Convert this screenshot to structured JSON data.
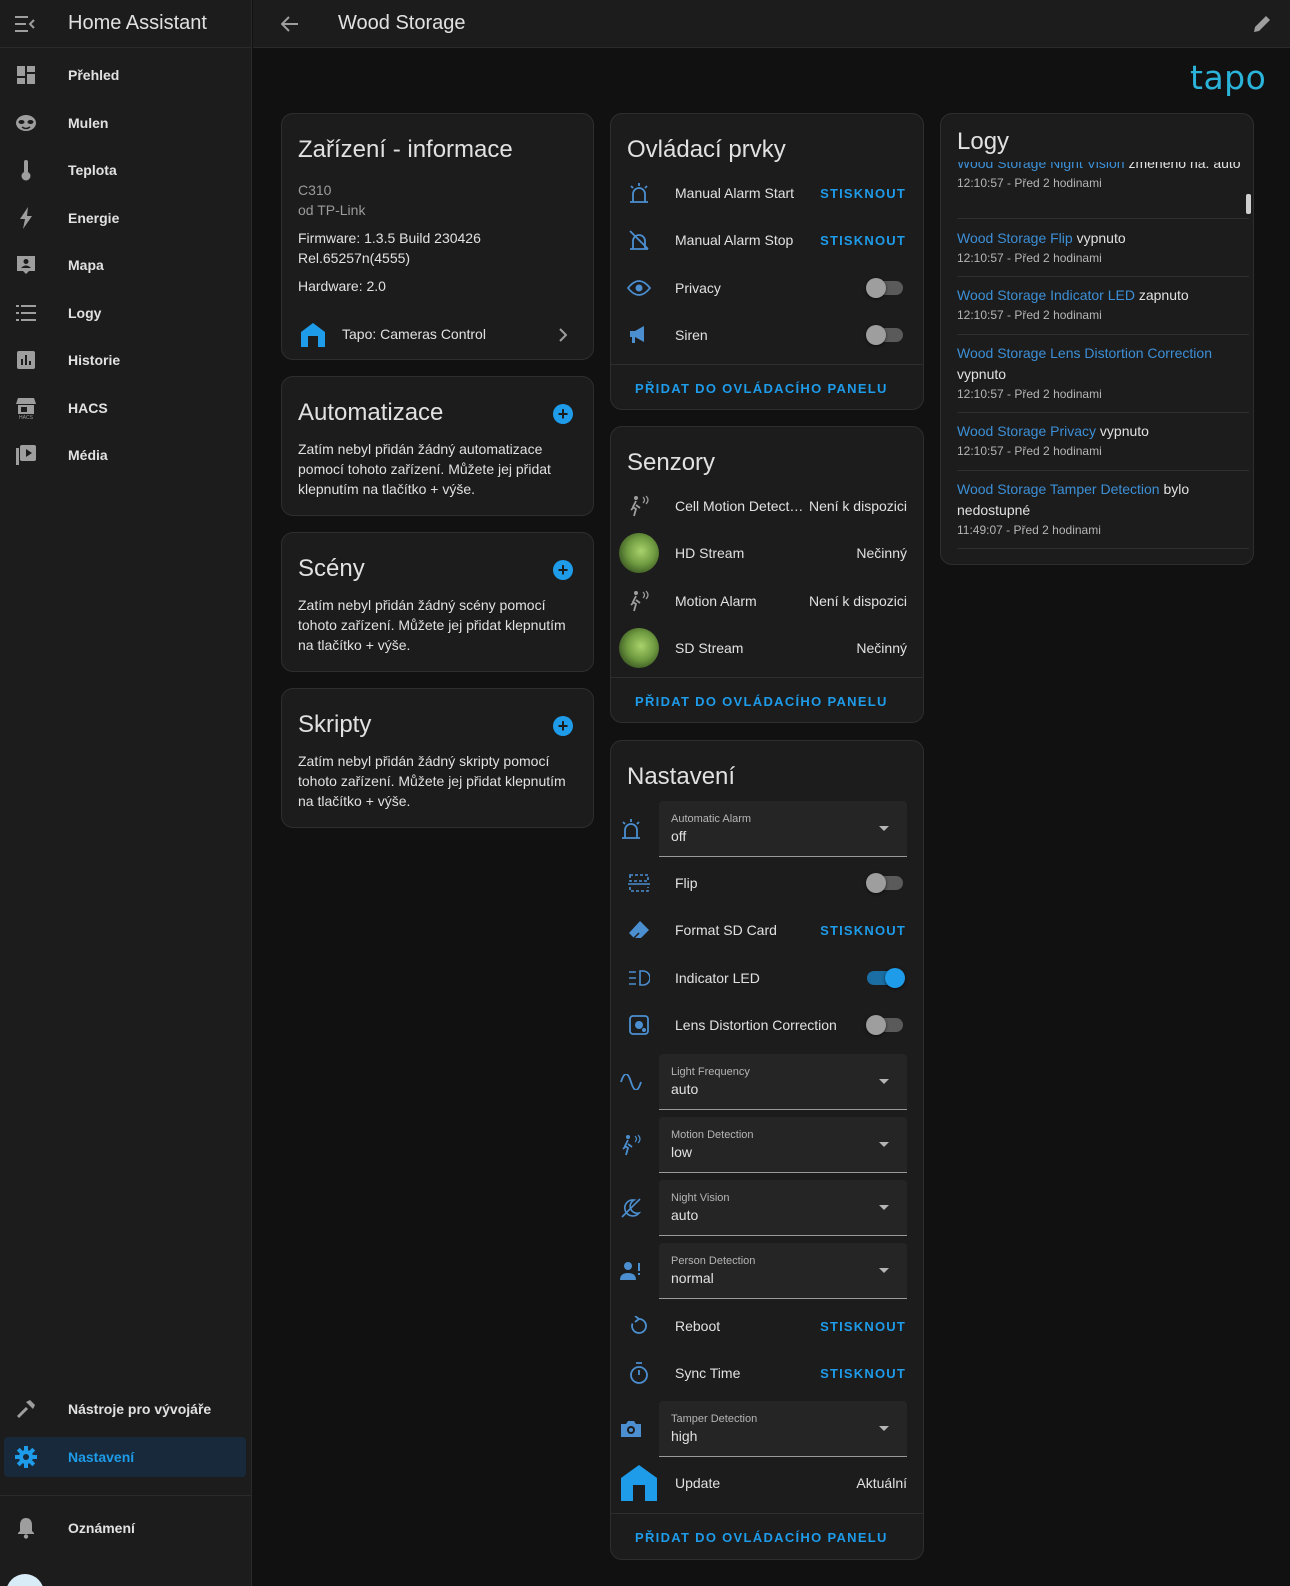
{
  "app": {
    "title": "Home Assistant"
  },
  "sidebar": {
    "items": [
      {
        "label": "Přehled",
        "icon": "dashboard-icon"
      },
      {
        "label": "Mulen",
        "icon": "mask-icon"
      },
      {
        "label": "Teplota",
        "icon": "thermometer-icon"
      },
      {
        "label": "Energie",
        "icon": "lightning-icon"
      },
      {
        "label": "Mapa",
        "icon": "map-account-icon"
      },
      {
        "label": "Logy",
        "icon": "format-list-icon"
      },
      {
        "label": "Historie",
        "icon": "chart-box-icon"
      },
      {
        "label": "HACS",
        "icon": "hacs-icon"
      },
      {
        "label": "Média",
        "icon": "play-box-icon"
      }
    ],
    "dev_tools": "Nástroje pro vývojáře",
    "settings": "Nastavení",
    "notifications": "Oznámení",
    "accent": "#1e9be9"
  },
  "header": {
    "title": "Wood Storage"
  },
  "brand": {
    "logo_text": "tapo",
    "color": "#2bb3d9"
  },
  "device_info": {
    "title": "Zařízení - informace",
    "model": "C310",
    "manufacturer": "od TP-Link",
    "firmware_line1": "Firmware: 1.3.5 Build 230426",
    "firmware_line2": "Rel.65257n(4555)",
    "hardware": "Hardware: 2.0",
    "integration": "Tapo: Cameras Control"
  },
  "automations": {
    "title": "Automatizace",
    "text": "Zatím nebyl přidán žádný automatizace pomocí tohoto zařízení. Můžete jej přidat klepnutím na tlačítko + výše."
  },
  "scenes": {
    "title": "Scény",
    "text": "Zatím nebyl přidán žádný scény pomocí tohoto zařízení. Můžete jej přidat klepnutím na tlačítko + výše."
  },
  "scripts": {
    "title": "Skripty",
    "text": "Zatím nebyl přidán žádný skripty pomocí tohoto zařízení. Můžete jej přidat klepnutím na tlačítko + výše."
  },
  "controls": {
    "title": "Ovládací prvky",
    "rows": [
      {
        "name": "Manual Alarm Start",
        "action": "STISKNOUT",
        "icon": "alarm-light-icon"
      },
      {
        "name": "Manual Alarm Stop",
        "action": "STISKNOUT",
        "icon": "alarm-light-off-icon"
      },
      {
        "name": "Privacy",
        "toggle": false,
        "icon": "eye-icon"
      },
      {
        "name": "Siren",
        "toggle": false,
        "icon": "bullhorn-icon"
      }
    ],
    "footer": "PŘIDAT DO OVLÁDACÍHO PANELU"
  },
  "sensors": {
    "title": "Senzory",
    "rows": [
      {
        "name": "Cell Motion Detecti…",
        "value": "Není k dispozici",
        "icon": "motion-sensor-icon"
      },
      {
        "name": "HD Stream",
        "value": "Nečinný",
        "icon": "camera-thumbnail"
      },
      {
        "name": "Motion Alarm",
        "value": "Není k dispozici",
        "icon": "motion-sensor-icon"
      },
      {
        "name": "SD Stream",
        "value": "Nečinný",
        "icon": "camera-thumbnail"
      }
    ],
    "footer": "PŘIDAT DO OVLÁDACÍHO PANELU"
  },
  "settings": {
    "title": "Nastavení",
    "automatic_alarm": {
      "label": "Automatic Alarm",
      "value": "off"
    },
    "flip": {
      "name": "Flip",
      "toggle": false
    },
    "format_sd": {
      "name": "Format SD Card",
      "action": "STISKNOUT"
    },
    "indicator_led": {
      "name": "Indicator LED",
      "toggle": true
    },
    "lens_distortion": {
      "name": "Lens Distortion Correction",
      "toggle": false
    },
    "light_frequency": {
      "label": "Light Frequency",
      "value": "auto"
    },
    "motion_detection": {
      "label": "Motion Detection",
      "value": "low"
    },
    "night_vision": {
      "label": "Night Vision",
      "value": "auto"
    },
    "person_detection": {
      "label": "Person Detection",
      "value": "normal"
    },
    "reboot": {
      "name": "Reboot",
      "action": "STISKNOUT"
    },
    "sync_time": {
      "name": "Sync Time",
      "action": "STISKNOUT"
    },
    "tamper_detection": {
      "label": "Tamper Detection",
      "value": "high"
    },
    "update": {
      "name": "Update",
      "value": "Aktuální"
    },
    "footer": "PŘIDAT DO OVLÁDACÍHO PANELU"
  },
  "logs": {
    "title": "Logy",
    "entries": [
      {
        "entity": "Wood Storage Night Vision",
        "state": "změněno na: auto",
        "time": "12:10:57 - Před 2 hodinami"
      },
      {
        "entity": "Wood Storage Flip",
        "state": "vypnuto",
        "time": "12:10:57 - Před 2 hodinami"
      },
      {
        "entity": "Wood Storage Indicator LED",
        "state": "zapnuto",
        "time": "12:10:57 - Před 2 hodinami"
      },
      {
        "entity": "Wood Storage Lens Distortion Correction",
        "state": "vypnuto",
        "time": "12:10:57 - Před 2 hodinami"
      },
      {
        "entity": "Wood Storage Privacy",
        "state": "vypnuto",
        "time": "12:10:57 - Před 2 hodinami"
      },
      {
        "entity": "Wood Storage Tamper Detection",
        "state": "bylo nedostupné",
        "time": "11:49:07 - Před 2 hodinami"
      }
    ]
  }
}
